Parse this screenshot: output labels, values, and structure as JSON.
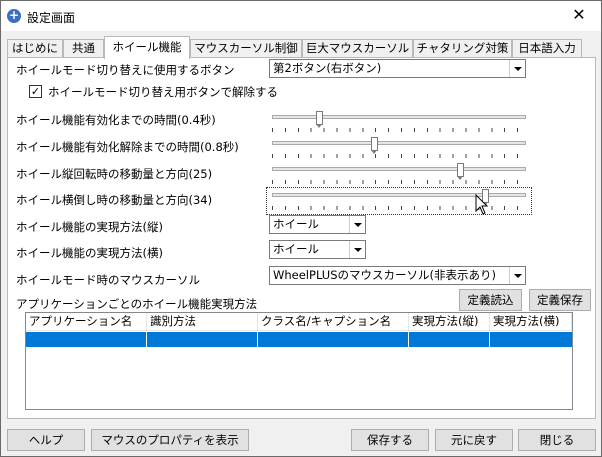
{
  "window": {
    "title": "設定画面",
    "close": "✕"
  },
  "tabs": [
    "はじめに",
    "共通",
    "ホイール機能",
    "マウスカーソル制御",
    "巨大マウスカーソル",
    "チャタリング対策",
    "日本語入力"
  ],
  "settings": {
    "toggle_button_label": "ホイールモード切り替えに使用するボタン",
    "toggle_button_value": "第2ボタン(右ボタン)",
    "release_checkbox_label": "ホイールモード切り替え用ボタンで解除する",
    "release_checked": true,
    "check_mark": "✓",
    "enable_time_label": "ホイール機能有効化までの時間(0.4秒)",
    "enable_time_level": 0.18,
    "disable_time_label": "ホイール機能有効化解除までの時間(0.8秒)",
    "disable_time_level": 0.4,
    "vertical_move_label": "ホイール縦回転時の移動量と方向(25)",
    "vertical_move_level": 0.75,
    "horizontal_move_label": "ホイール横倒し時の移動量と方向(34)",
    "horizontal_move_level": 0.85,
    "impl_vertical_label": "ホイール機能の実現方法(縦)",
    "impl_vertical_value": "ホイール",
    "impl_horizontal_label": "ホイール機能の実現方法(横)",
    "impl_horizontal_value": "ホイール",
    "cursor_label": "ホイールモード時のマウスカーソル",
    "cursor_value": "WheelPLUSのマウスカーソル(非表示あり)",
    "per_app_label": "アプリケーションごとのホイール機能実現方法",
    "load_def": "定義読込",
    "save_def": "定義保存"
  },
  "table": {
    "columns": [
      "アプリケーション名",
      "識別方法",
      "クラス名/キャプション名",
      "実現方法(縦)",
      "実現方法(横)"
    ]
  },
  "footer": {
    "help": "ヘルプ",
    "mouse_props": "マウスのプロパティを表示",
    "save": "保存する",
    "revert": "元に戻す",
    "close": "閉じる"
  },
  "colors": {
    "selection": "#0078d7",
    "accent_icon": "#3b6fc0"
  }
}
